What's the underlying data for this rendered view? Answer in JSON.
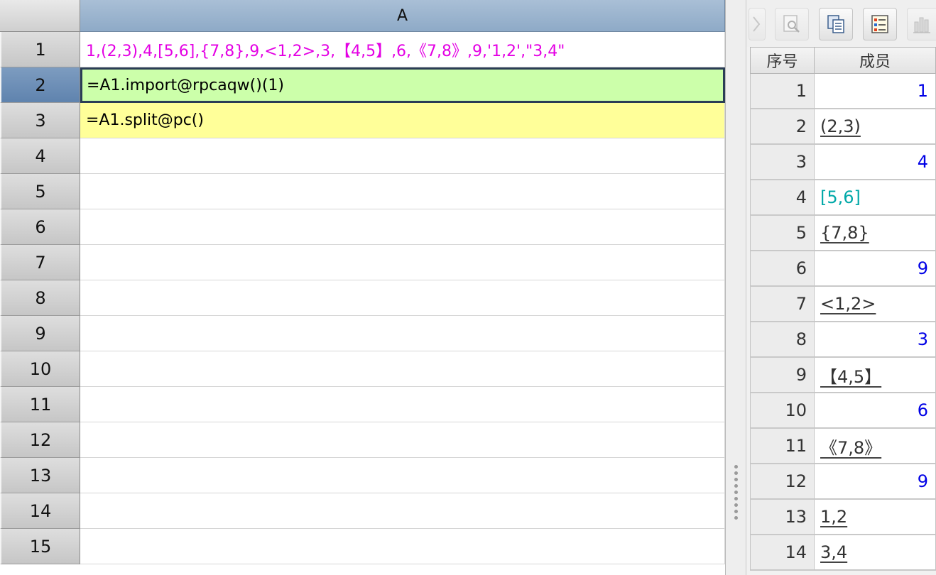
{
  "sheet": {
    "column_header": "A",
    "rows": [
      {
        "num": "1",
        "value": "1,(2,3),4,[5,6],{7,8},9,<1,2>,3,【4,5】,6,《7,8》,9,'1,2',\"3,4\"",
        "style": "const"
      },
      {
        "num": "2",
        "value": "=A1.import@rpcaqw()(1)",
        "style": "green"
      },
      {
        "num": "3",
        "value": "=A1.split@pc()",
        "style": "yellow"
      },
      {
        "num": "4",
        "value": "",
        "style": ""
      },
      {
        "num": "5",
        "value": "",
        "style": ""
      },
      {
        "num": "6",
        "value": "",
        "style": ""
      },
      {
        "num": "7",
        "value": "",
        "style": ""
      },
      {
        "num": "8",
        "value": "",
        "style": ""
      },
      {
        "num": "9",
        "value": "",
        "style": ""
      },
      {
        "num": "10",
        "value": "",
        "style": ""
      },
      {
        "num": "11",
        "value": "",
        "style": ""
      },
      {
        "num": "12",
        "value": "",
        "style": ""
      },
      {
        "num": "13",
        "value": "",
        "style": ""
      },
      {
        "num": "14",
        "value": "",
        "style": ""
      },
      {
        "num": "15",
        "value": "",
        "style": ""
      }
    ],
    "active_row": "2"
  },
  "toolbar": {
    "buttons": [
      {
        "name": "collapse-button",
        "icon": "arrow-icon",
        "disabled": true
      },
      {
        "name": "preview-button",
        "icon": "magnifier-icon",
        "disabled": true
      },
      {
        "name": "copy-button",
        "icon": "copy-icon",
        "disabled": false
      },
      {
        "name": "table-view-button",
        "icon": "checklist-icon",
        "disabled": false
      },
      {
        "name": "chart-button",
        "icon": "chart-icon",
        "disabled": true
      }
    ]
  },
  "value_panel": {
    "header_index": "序号",
    "header_member": "成员",
    "rows": [
      {
        "idx": "1",
        "value": "1",
        "kind": "num"
      },
      {
        "idx": "2",
        "value": "(2,3)",
        "kind": "txt"
      },
      {
        "idx": "3",
        "value": "4",
        "kind": "num"
      },
      {
        "idx": "4",
        "value": "[5,6]",
        "kind": "seq"
      },
      {
        "idx": "5",
        "value": "{7,8}",
        "kind": "txt"
      },
      {
        "idx": "6",
        "value": "9",
        "kind": "num"
      },
      {
        "idx": "7",
        "value": "<1,2>",
        "kind": "txt"
      },
      {
        "idx": "8",
        "value": "3",
        "kind": "num"
      },
      {
        "idx": "9",
        "value": "【4,5】",
        "kind": "txt"
      },
      {
        "idx": "10",
        "value": "6",
        "kind": "num"
      },
      {
        "idx": "11",
        "value": "《7,8》",
        "kind": "txt"
      },
      {
        "idx": "12",
        "value": "9",
        "kind": "num"
      },
      {
        "idx": "13",
        "value": "1,2",
        "kind": "txt"
      },
      {
        "idx": "14",
        "value": "3,4",
        "kind": "txt"
      }
    ]
  },
  "colors": {
    "constant_text": "#e400e4",
    "number_value": "#0000e6",
    "sequence_value": "#00a8a8",
    "green_cell": "#ccffaa",
    "yellow_cell": "#ffff99",
    "column_header": "#8eaac7"
  }
}
